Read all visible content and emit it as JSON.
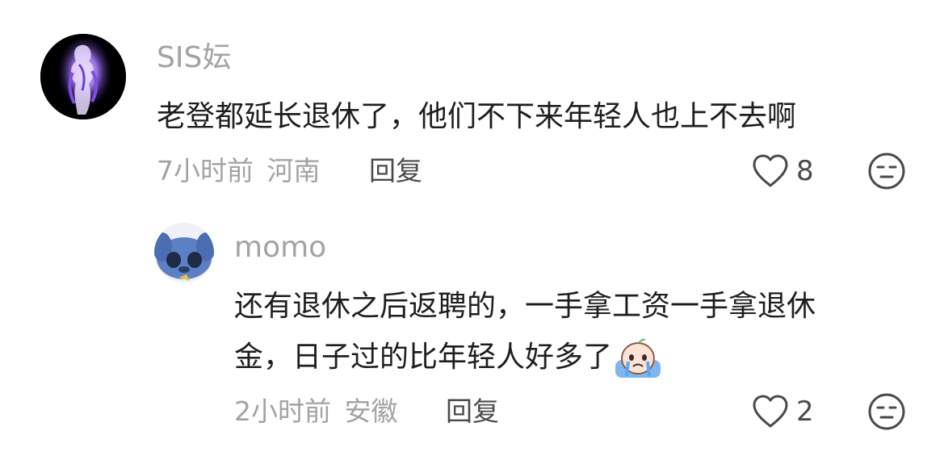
{
  "comments": [
    {
      "username": "SIS妘",
      "text": "老登都延长退休了，他们不下来年轻人也上不去啊",
      "time": "7小时前",
      "location": "河南",
      "reply_label": "回复",
      "likes": "8",
      "avatar_icon": "purple-figure-avatar"
    }
  ],
  "replies": [
    {
      "username": "momo",
      "text_line1": "还有退休之后返聘的，一手拿工资一手拿退休",
      "text_line2": "金，日子过的比年轻人好多了",
      "emoji_icon": "crying-peach-emoji",
      "time": "2小时前",
      "location": "安徽",
      "reply_label": "回复",
      "likes": "2",
      "avatar_icon": "stitch-avatar"
    }
  ],
  "colors": {
    "meta_gray": "#a3a3a3",
    "text_dark": "#1e1e1e",
    "icon_gray": "#4a4a4a"
  }
}
